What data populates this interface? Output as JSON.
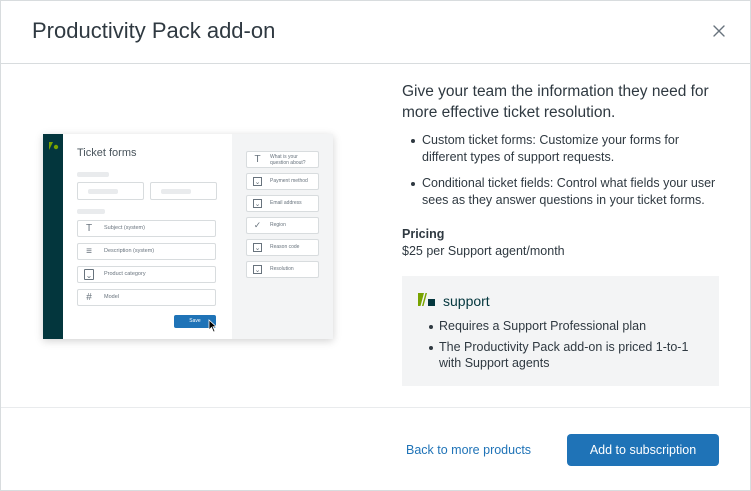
{
  "modal": {
    "title": "Productivity Pack add-on",
    "close_icon": "close-icon"
  },
  "preview": {
    "title": "Ticket forms",
    "fields": [
      {
        "icon": "T",
        "label": "Subject (system)"
      },
      {
        "icon": "≡",
        "label": "Description (system)"
      },
      {
        "icon": "⌄",
        "label": "Product category"
      },
      {
        "icon": "#",
        "label": "Model"
      }
    ],
    "save_label": "Save",
    "side_fields": [
      {
        "icon": "T",
        "label": "What is your question about?"
      },
      {
        "icon": "⌄",
        "label": "Payment method"
      },
      {
        "icon": "⌄",
        "label": "Email address"
      },
      {
        "icon": "✓",
        "label": "Region"
      },
      {
        "icon": "⌄",
        "label": "Reason code"
      },
      {
        "icon": "⌄",
        "label": "Resolution"
      }
    ]
  },
  "content": {
    "heading": "Give your team the information they need for more effective ticket resolution.",
    "bullets": [
      "Custom ticket forms: Customize your forms for different types of support requests.",
      "Conditional ticket fields: Control what fields your user sees as they answer questions in your ticket forms."
    ],
    "pricing_label": "Pricing",
    "pricing_value": "$25 per Support agent/month"
  },
  "support_box": {
    "product_name": "support",
    "items": [
      "Requires a Support Professional plan",
      "The Productivity Pack add-on is priced 1-to-1 with Support agents"
    ]
  },
  "footer": {
    "back_label": "Back to more products",
    "add_label": "Add to subscription"
  },
  "colors": {
    "accent": "#1f73b7",
    "brand_dark": "#03363d",
    "text": "#2f3941"
  }
}
